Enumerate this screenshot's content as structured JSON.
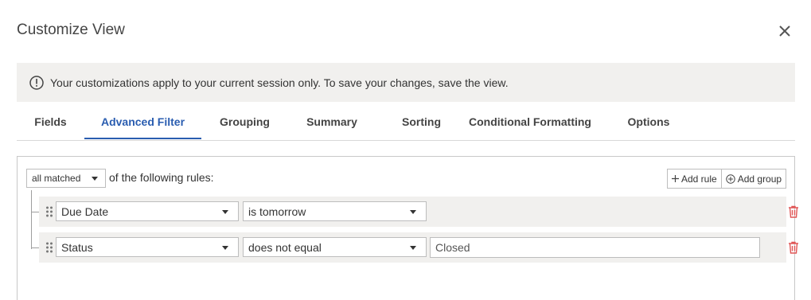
{
  "dialog": {
    "title": "Customize View",
    "close_icon": "close-icon"
  },
  "notice": {
    "icon": "info-circle-icon",
    "message": "Your customizations apply to your current session only. To save your changes, save the view."
  },
  "tabs": [
    {
      "label": "Fields",
      "active": false
    },
    {
      "label": "Advanced Filter",
      "active": true
    },
    {
      "label": "Grouping",
      "active": false
    },
    {
      "label": "Summary",
      "active": false
    },
    {
      "label": "Sorting",
      "active": false
    },
    {
      "label": "Conditional Formatting",
      "active": false
    },
    {
      "label": "Options",
      "active": false
    }
  ],
  "filter": {
    "match_mode": "all matched",
    "rules_label": "of the following rules:",
    "add_rule_label": "Add rule",
    "add_group_label": "Add group",
    "rules": [
      {
        "field": "Due Date",
        "operator": "is tomorrow",
        "value": null
      },
      {
        "field": "Status",
        "operator": "does not equal",
        "value": "Closed"
      }
    ]
  },
  "colors": {
    "accent": "#2a5db0",
    "danger": "#e05555",
    "notice_bg": "#f1f0ee"
  }
}
